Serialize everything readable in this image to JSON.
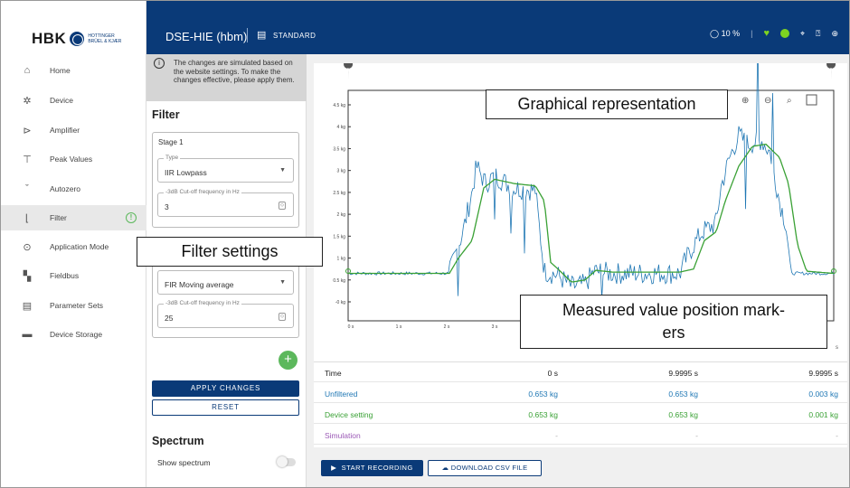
{
  "brand": {
    "name": "HBK",
    "sub1": "HOTTINGER",
    "sub2": "BRÜEL & KJÆR"
  },
  "header": {
    "device_title": "DSE-HIE (hbm)",
    "mode_label": "STANDARD",
    "cpu_percent": "10 %"
  },
  "sidebar": {
    "items": [
      {
        "label": "Home",
        "icon": "home-icon"
      },
      {
        "label": "Device",
        "icon": "gear-icon"
      },
      {
        "label": "Amplifier",
        "icon": "amplifier-icon"
      },
      {
        "label": "Peak Values",
        "icon": "peak-icon"
      },
      {
        "label": "Autozero",
        "icon": "autozero-icon"
      },
      {
        "label": "Filter",
        "icon": "filter-icon"
      },
      {
        "label": "Application Mode",
        "icon": "target-icon"
      },
      {
        "label": "Fieldbus",
        "icon": "fieldbus-icon"
      },
      {
        "label": "Parameter Sets",
        "icon": "parameter-icon"
      },
      {
        "label": "Device Storage",
        "icon": "folder-icon"
      }
    ]
  },
  "panel": {
    "notice": "The changes are simulated based on the website settings. To make the changes effective, please apply them.",
    "filter_title": "Filter",
    "stage1": {
      "label": "Stage 1",
      "type_legend": "Type",
      "type_value": "IIR Lowpass",
      "cutoff_legend": "-3dB Cut-off frequency in Hz",
      "cutoff_value": "3"
    },
    "stage2": {
      "type_value": "FIR Moving average",
      "cutoff_legend": "-3dB Cut-off frequency in Hz",
      "cutoff_value": "25"
    },
    "add_label": "+",
    "apply_label": "APPLY CHANGES",
    "reset_label": "RESET",
    "spectrum_title": "Spectrum",
    "show_spectrum_label": "Show spectrum"
  },
  "chart": {
    "y_ticks": [
      "4.5 kg",
      "4 kg",
      "3.5 kg",
      "3 kg",
      "2.5 kg",
      "2 kg",
      "1.5 kg",
      "1 kg",
      "0.5 kg",
      "-0 kg"
    ],
    "x_ticks": [
      "0 s",
      "1 s",
      "2 s",
      "3 s"
    ],
    "x_end_label": "s",
    "marker1": "1",
    "marker2": "2",
    "unfiltered_color": "#1f77b4",
    "device_color": "#3aa135"
  },
  "values": {
    "time": {
      "label": "Time",
      "v1": "0 s",
      "v2": "9.9995  s",
      "v3": "9.9995  s"
    },
    "unfiltered": {
      "label": "Unfiltered",
      "v1": "0.653  kg",
      "v2": "0.653  kg",
      "v3": "0.003  kg"
    },
    "device": {
      "label": "Device setting",
      "v1": "0.653  kg",
      "v2": "0.653  kg",
      "v3": "0.001  kg"
    },
    "simulation": {
      "label": "Simulation",
      "v1": "-",
      "v2": "-",
      "v3": "-"
    }
  },
  "actions": {
    "record_label": "START RECORDING",
    "csv_label": "DOWNLOAD CSV FILE"
  },
  "callouts": {
    "graph": "Graphical representation",
    "filter": "Filter settings",
    "markers_line1": "Measured value position mark-",
    "markers_line2": "ers"
  }
}
